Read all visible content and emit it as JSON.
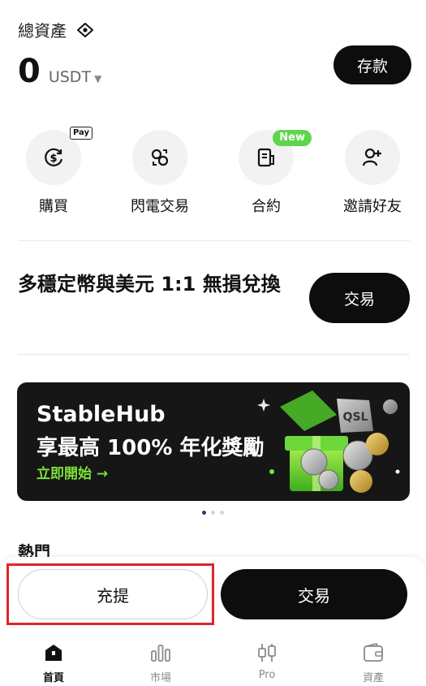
{
  "header": {
    "total_label": "總資產",
    "balance_value": "0",
    "balance_unit": "USDT",
    "deposit_label": "存款"
  },
  "quick_actions": [
    {
      "label": "購買",
      "icon": "dollar-refresh-icon",
      "badge": "Pay"
    },
    {
      "label": "閃電交易",
      "icon": "swap-circles-icon"
    },
    {
      "label": "合約",
      "icon": "contract-document-icon",
      "badge": "New"
    },
    {
      "label": "邀請好友",
      "icon": "add-user-icon"
    }
  ],
  "promo": {
    "text": "多穩定幣與美元 1:1 無損兌換",
    "button_label": "交易"
  },
  "banner": {
    "title": "StableHub",
    "subtitle": "享最高 100% 年化獎勵",
    "cta": "立即開始 →"
  },
  "carousel": {
    "count": 3,
    "active": 0
  },
  "hot_section": {
    "title": "熱門"
  },
  "bottom_actions": {
    "recharge_label": "充提",
    "trade_label": "交易"
  },
  "tabs": [
    {
      "label": "首頁",
      "icon": "home-icon",
      "active": true
    },
    {
      "label": "市場",
      "icon": "market-bars-icon",
      "active": false
    },
    {
      "label": "Pro",
      "icon": "candlestick-icon",
      "active": false
    },
    {
      "label": "資產",
      "icon": "wallet-icon",
      "active": false
    }
  ],
  "colors": {
    "primary_dark": "#0d0d0d",
    "accent_green": "#5cd64a",
    "banner_green": "#7ee03a",
    "highlight_red": "#e0242b"
  }
}
